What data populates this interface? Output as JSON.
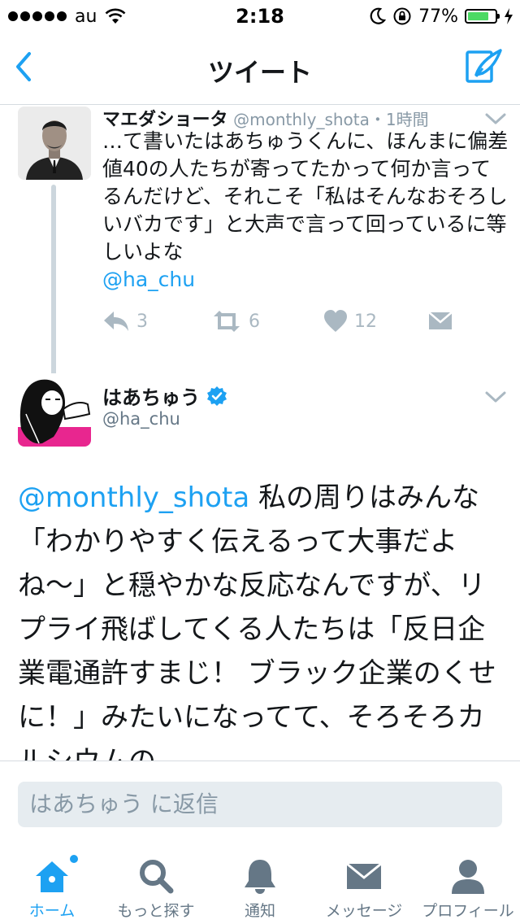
{
  "status_bar": {
    "carrier": "au",
    "time": "2:18",
    "battery": "77%",
    "battery_level": 0.77
  },
  "nav": {
    "title": "ツイート"
  },
  "quoted_tweet": {
    "name": "マエダショータ",
    "handle": "@monthly_shota",
    "time": "・1時間",
    "text": "…て書いたはあちゅうくんに、ほんまに偏差値40の人たちが寄ってたかって何か言ってるんだけど、それこそ「私はそんなおそろしいバカです」と大声で言って回っているに等しいよな",
    "mention": "@ha_chu",
    "reply_count": "3",
    "retweet_count": "6",
    "like_count": "12"
  },
  "main_tweet": {
    "name": "はあちゅう",
    "handle": "@ha_chu",
    "mention": "@monthly_shota",
    "text": " 私の周りはみんな「わかりやすく伝えるって大事だよね〜」と穏やかな反応なんですが、リプライ飛ばしてくる人たちは「反日企業電通許すまじ！ ブラック企業のくせに！」みたいになってて、そろそろカルシウムの"
  },
  "reply": {
    "placeholder": "はあちゅう に返信"
  },
  "tabs": [
    {
      "label": "ホーム",
      "icon": "home-icon",
      "active": true
    },
    {
      "label": "もっと探す",
      "icon": "search-icon"
    },
    {
      "label": "通知",
      "icon": "bell-icon"
    },
    {
      "label": "メッセージ",
      "icon": "envelope-icon"
    },
    {
      "label": "プロフィール",
      "icon": "person-icon"
    }
  ],
  "colors": {
    "accent": "#1da1f2",
    "muted": "#8899a6",
    "text": "#14171a"
  }
}
